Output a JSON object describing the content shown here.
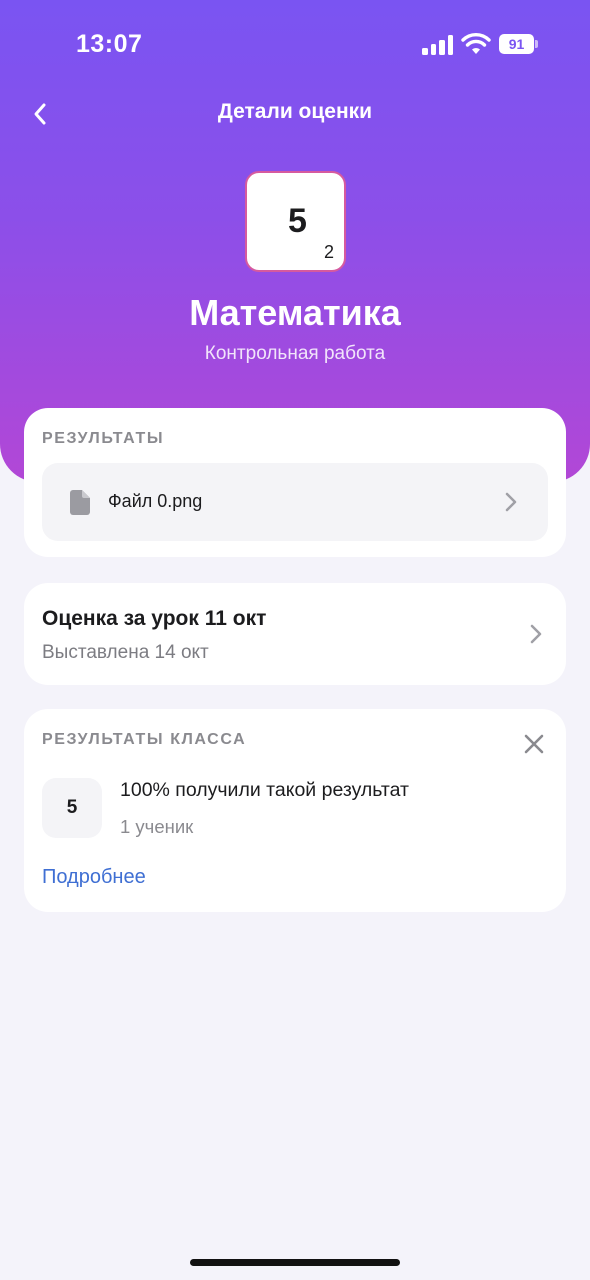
{
  "status_bar": {
    "time": "13:07",
    "battery": "91"
  },
  "nav": {
    "title": "Детали оценки"
  },
  "grade": {
    "value": "5",
    "weight": "2"
  },
  "subject": {
    "name": "Математика",
    "work_type": "Контрольная работа"
  },
  "results": {
    "header": "РЕЗУЛЬТАТЫ",
    "file": {
      "name": "Файл 0.png",
      "icon": "file-icon"
    }
  },
  "lesson": {
    "title": "Оценка за урок 11 окт",
    "subtitle": "Выставлена 14 окт"
  },
  "class_results": {
    "header": "РЕЗУЛЬТАТЫ КЛАССА",
    "grade": "5",
    "text": "100% получили такой результат",
    "count": "1 ученик",
    "more_link": "Подробнее"
  },
  "colors": {
    "gradient_top": "#7a54f2",
    "gradient_bottom": "#b247d6",
    "grade_border": "#d65a9f",
    "link": "#3f6fd3",
    "background": "#f4f3fa"
  }
}
